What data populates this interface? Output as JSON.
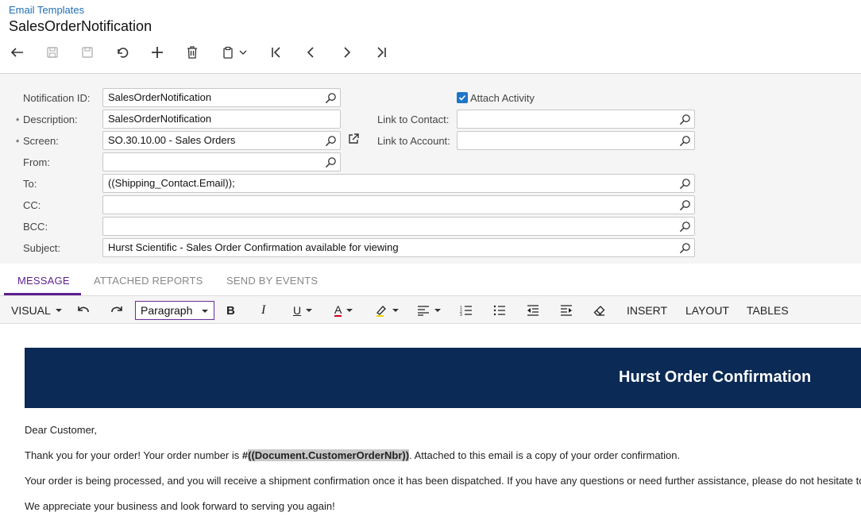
{
  "header": {
    "breadcrumb": "Email Templates",
    "title": "SalesOrderNotification"
  },
  "form": {
    "notification_id": {
      "label": "Notification ID:",
      "value": "SalesOrderNotification"
    },
    "description": {
      "label": "Description:",
      "value": "SalesOrderNotification",
      "required_mark": "*"
    },
    "screen": {
      "label": "Screen:",
      "value": "SO.30.10.00 - Sales Orders",
      "required_mark": "*"
    },
    "from": {
      "label": "From:",
      "value": ""
    },
    "to": {
      "label": "To:",
      "value": "((Shipping_Contact.Email));"
    },
    "cc": {
      "label": "CC:",
      "value": ""
    },
    "bcc": {
      "label": "BCC:",
      "value": ""
    },
    "subject": {
      "label": "Subject:",
      "value": "Hurst Scientific - Sales Order Confirmation available for viewing"
    },
    "attach_activity": {
      "label": "Attach Activity",
      "checked": true
    },
    "link_to_contact": {
      "label": "Link to Contact:",
      "value": ""
    },
    "link_to_account": {
      "label": "Link to Account:",
      "value": ""
    }
  },
  "tabs": [
    {
      "label": "MESSAGE",
      "active": true
    },
    {
      "label": "ATTACHED REPORTS",
      "active": false
    },
    {
      "label": "SEND BY EVENTS",
      "active": false
    }
  ],
  "editor": {
    "mode": "VISUAL",
    "paragraph_style": "Paragraph",
    "menus": {
      "insert": "INSERT",
      "layout": "LAYOUT",
      "tables": "TABLES"
    }
  },
  "email": {
    "banner_title": "Hurst Order Confirmation",
    "banner_color": "#0b2a55",
    "greeting": "Dear Customer,",
    "line1_prefix": "Thank you for your order! Your order number is ",
    "line1_hash": "#",
    "line1_placeholder": "((Document.CustomerOrderNbr))",
    "line1_suffix": ". Attached to this email is a copy of your order confirmation.",
    "line2": "Your order is being processed, and you will receive a shipment confirmation once it has been dispatched. If you have any questions or need further assistance, please do not hesitate to",
    "line3": "We appreciate your business and look forward to serving you again!"
  },
  "colors": {
    "accent": "#5c1f8e",
    "link": "#1f6fb5",
    "checkbox": "#1e76c8"
  }
}
